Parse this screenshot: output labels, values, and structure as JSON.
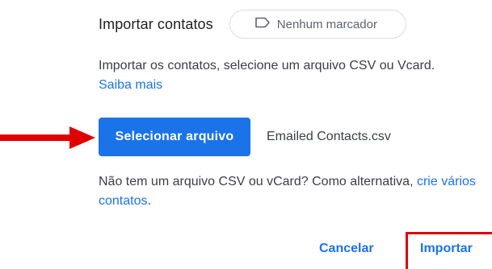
{
  "dialog": {
    "title": "Importar contatos",
    "label_chip": "Nenhum marcador",
    "description": "Importar os contatos, selecione um arquivo CSV ou Vcard.",
    "learn_more": "Saiba mais",
    "select_file_button": "Selecionar arquivo",
    "selected_file": "Emailed Contacts.csv",
    "alt_text": "Não tem um arquivo CSV ou vCard? Como alternativa,",
    "alt_link": "crie vários contatos",
    "alt_suffix": ".",
    "cancel_button": "Cancelar",
    "import_button": "Importar"
  },
  "colors": {
    "accent": "#1a73e8",
    "annotation": "#e00000"
  },
  "icons": {
    "chip_icon": "label-outline-icon",
    "pointer": "red-arrow-annotation"
  }
}
